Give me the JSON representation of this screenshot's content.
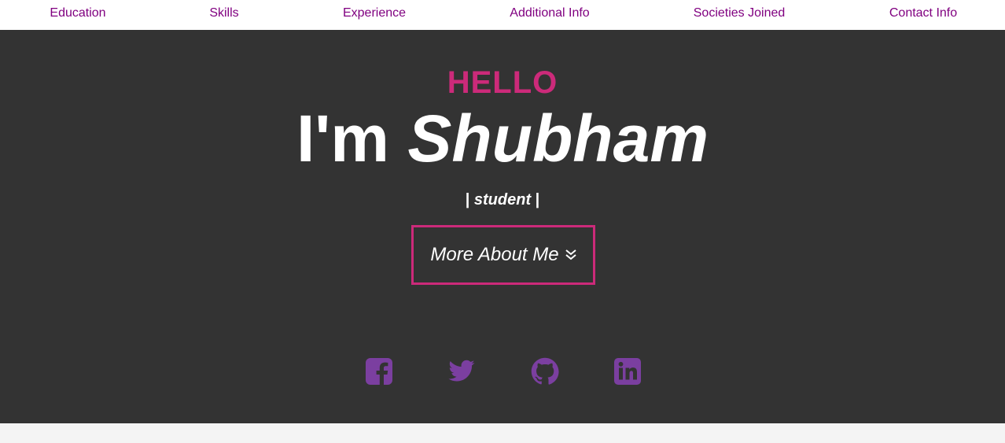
{
  "nav": {
    "items": [
      {
        "label": "Education"
      },
      {
        "label": "Skills"
      },
      {
        "label": "Experience"
      },
      {
        "label": "Additional Info"
      },
      {
        "label": "Societies Joined"
      },
      {
        "label": "Contact Info"
      }
    ]
  },
  "hero": {
    "greeting": "HELLO",
    "intro_prefix": "I'm",
    "name": "Shubham",
    "role_prefix": "|",
    "role": "student",
    "role_suffix": "|",
    "more_button_label": "More About Me"
  },
  "social": {
    "icons": [
      "facebook-icon",
      "twitter-icon",
      "github-icon",
      "linkedin-icon"
    ]
  },
  "colors": {
    "accent": "#cc2a7a",
    "nav_link": "#800080",
    "social_icon": "#7b3fa0",
    "hero_bg": "#333333"
  }
}
